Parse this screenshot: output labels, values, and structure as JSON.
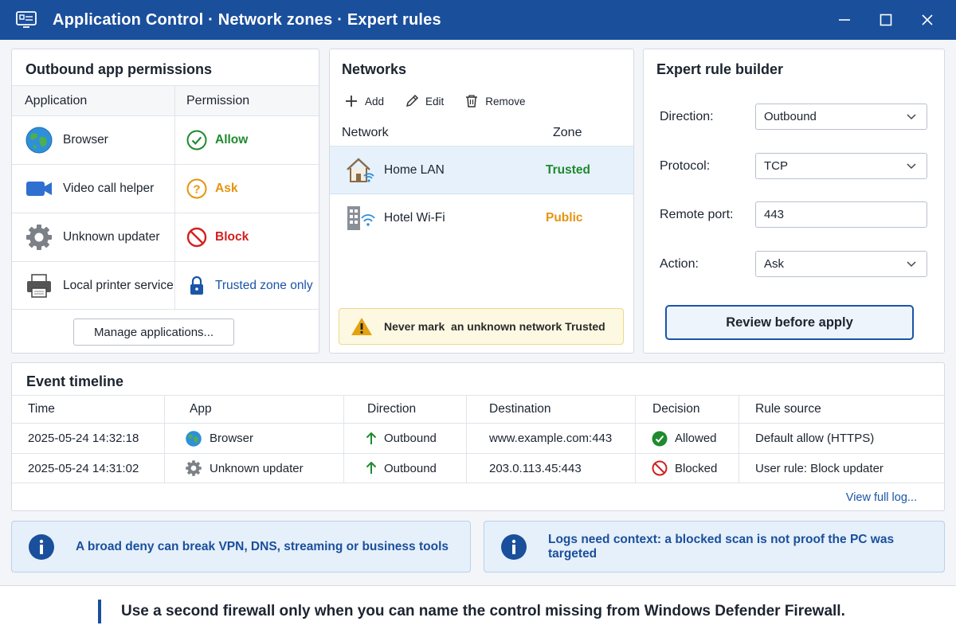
{
  "window": {
    "title": "Application Control · Network zones · Expert rules",
    "accent": "#1a4f9c"
  },
  "permissions": {
    "title": "Outbound app permissions",
    "col_app": "Application",
    "col_perm": "Permission",
    "rows": [
      {
        "app": "Browser",
        "icon": "globe-icon",
        "permission": "Allow",
        "perm_icon": "check-circle-icon"
      },
      {
        "app": "Video call helper",
        "icon": "video-camera-icon",
        "permission": "Ask",
        "perm_icon": "question-circle-icon"
      },
      {
        "app": "Unknown updater",
        "icon": "gear-icon",
        "permission": "Block",
        "perm_icon": "block-icon"
      },
      {
        "app": "Local printer service",
        "icon": "printer-icon",
        "permission": "Trusted zone only",
        "perm_icon": "lock-icon"
      }
    ],
    "manage_label": "Manage applications..."
  },
  "networks": {
    "title": "Networks",
    "toolbar": {
      "add": "Add",
      "edit": "Edit",
      "remove": "Remove"
    },
    "col_network": "Network",
    "col_zone": "Zone",
    "rows": [
      {
        "name": "Home LAN",
        "zone": "Trusted",
        "icon": "home-wifi-icon",
        "selected": true
      },
      {
        "name": "Hotel Wi-Fi",
        "zone": "Public",
        "icon": "building-wifi-icon",
        "selected": false
      }
    ],
    "warning": "Never mark  an unknown network Trusted"
  },
  "rule_builder": {
    "title": "Expert rule builder",
    "direction_label": "Direction:",
    "direction_value": "Outbound",
    "protocol_label": "Protocol:",
    "protocol_value": "TCP",
    "port_label": "Remote port:",
    "port_value": "443",
    "action_label": "Action:",
    "action_value": "Ask",
    "review_label": "Review before apply"
  },
  "timeline": {
    "title": "Event timeline",
    "columns": [
      "Time",
      "App",
      "Direction",
      "Destination",
      "Decision",
      "Rule source"
    ],
    "rows": [
      {
        "time": "2025-05-24 14:32:18",
        "app": "Browser",
        "direction": "Outbound",
        "destination": "www.example.com:443",
        "decision": "Allowed",
        "source": "Default allow (HTTPS)"
      },
      {
        "time": "2025-05-24 14:31:02",
        "app": "Unknown updater",
        "direction": "Outbound",
        "destination": "203.0.113.45:443",
        "decision": "Blocked",
        "source": "User rule: Block updater"
      }
    ],
    "view_log": "View full log..."
  },
  "info": {
    "left": "A broad deny can break VPN, DNS, streaming or business tools",
    "right": "Logs need context: a blocked scan is not proof the PC was targeted"
  },
  "footer": {
    "message": "Use a second firewall only when you can name the control missing from Windows Defender Firewall."
  }
}
